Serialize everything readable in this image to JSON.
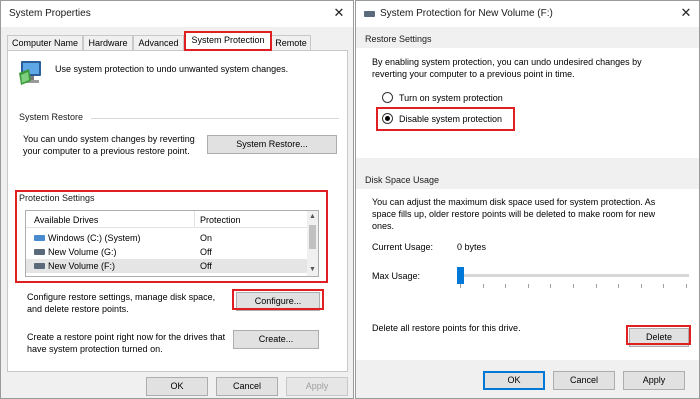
{
  "left": {
    "title": "System Properties",
    "tabs": [
      "Computer Name",
      "Hardware",
      "Advanced",
      "System Protection",
      "Remote"
    ],
    "intro": "Use system protection to undo unwanted system changes.",
    "system_restore": {
      "heading": "System Restore",
      "text_line1": "You can undo system changes by reverting",
      "text_line2": "your computer to a previous restore point.",
      "button": "System Restore..."
    },
    "protection": {
      "heading": "Protection Settings",
      "col_drives": "Available Drives",
      "col_protection": "Protection",
      "rows": [
        {
          "drive": "Windows (C:) (System)",
          "status": "On"
        },
        {
          "drive": "New Volume (G:)",
          "status": "Off"
        },
        {
          "drive": "New Volume (F:)",
          "status": "Off"
        }
      ]
    },
    "configure": {
      "text_line1": "Configure restore settings, manage disk space,",
      "text_line2": "and delete restore points.",
      "button": "Configure..."
    },
    "create": {
      "text_line1": "Create a restore point right now for the drives that",
      "text_line2": "have system protection turned on.",
      "button": "Create..."
    },
    "footer": {
      "ok": "OK",
      "cancel": "Cancel",
      "apply": "Apply"
    }
  },
  "right": {
    "title": "System Protection for New Volume (F:)",
    "restore_settings": {
      "heading": "Restore Settings",
      "desc_line1": "By enabling system protection, you can undo undesired changes by",
      "desc_line2": "reverting your computer to a previous point in time.",
      "opt_on": "Turn on system protection",
      "opt_off": "Disable system protection"
    },
    "disk": {
      "heading": "Disk Space Usage",
      "desc_line1": "You can adjust the maximum disk space used for system protection. As",
      "desc_line2": "space fills up, older restore points will be deleted to make room for new",
      "desc_line3": "ones.",
      "current_label": "Current Usage:",
      "current_value": "0 bytes",
      "max_label": "Max Usage:",
      "max_fraction": 0
    },
    "delete_text": "Delete all restore points for this drive.",
    "delete_button": "Delete",
    "footer": {
      "ok": "OK",
      "cancel": "Cancel",
      "apply": "Apply"
    }
  }
}
